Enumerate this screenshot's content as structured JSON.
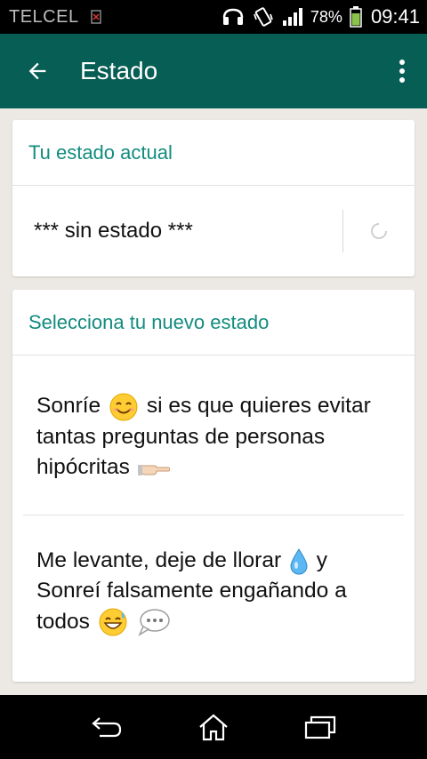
{
  "status_bar": {
    "carrier": "TELCEL",
    "battery": "78%",
    "time": "09:41"
  },
  "app_bar": {
    "title": "Estado"
  },
  "current_section": {
    "header": "Tu estado actual",
    "value": "*** sin estado ***"
  },
  "new_section": {
    "header": "Selecciona tu nuevo estado",
    "items": [
      {
        "line1_a": "Sonríe",
        "line1_b": "si es que quieres evitar",
        "line2": "tantas preguntas de personas",
        "line3": "hipócritas"
      },
      {
        "line1_a": "Me levante, deje de llorar",
        "line1_b": "y",
        "line2": "Sonreí  falsamente engañando a",
        "line3": "todos"
      }
    ]
  },
  "colors": {
    "app_bar": "#075e54",
    "accent": "#128c7e",
    "background": "#ece9e4"
  },
  "icons": [
    "back-arrow-icon",
    "overflow-menu-icon",
    "edit-icon",
    "back-nav-icon",
    "home-nav-icon",
    "recents-nav-icon"
  ]
}
